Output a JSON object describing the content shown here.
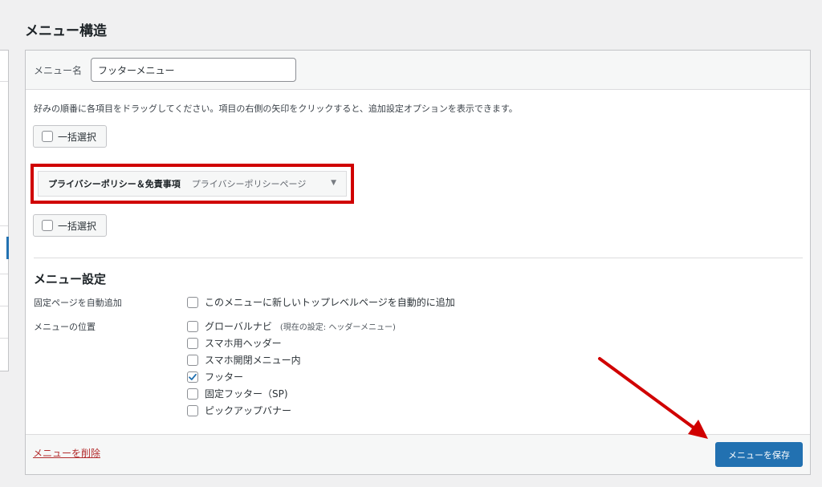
{
  "page": {
    "title": "メニュー構造"
  },
  "header": {
    "name_label": "メニュー名",
    "name_value": "フッターメニュー"
  },
  "instructions": "好みの順番に各項目をドラッグしてください。項目の右側の矢印をクリックすると、追加設定オプションを表示できます。",
  "bulk_select": {
    "label": "一括選択"
  },
  "menu_items": [
    {
      "title": "プライバシーポリシー＆免責事項",
      "type": "プライバシーポリシーページ"
    }
  ],
  "settings": {
    "heading": "メニュー設定",
    "auto_add": {
      "label": "固定ページを自動追加",
      "option": "このメニューに新しいトップレベルページを自動的に追加",
      "checked": false
    },
    "locations": {
      "label": "メニューの位置",
      "options": [
        {
          "label": "グローバルナビ",
          "note": "(現在の設定: ヘッダーメニュー)",
          "checked": false
        },
        {
          "label": "スマホ用ヘッダー",
          "note": "",
          "checked": false
        },
        {
          "label": "スマホ開閉メニュー内",
          "note": "",
          "checked": false
        },
        {
          "label": "フッター",
          "note": "",
          "checked": true
        },
        {
          "label": "固定フッター（SP)",
          "note": "",
          "checked": false
        },
        {
          "label": "ピックアップバナー",
          "note": "",
          "checked": false
        }
      ]
    }
  },
  "footer": {
    "delete_label": "メニューを削除",
    "save_label": "メニューを保存"
  },
  "colors": {
    "primary": "#2271b1",
    "danger": "#b32d2e",
    "highlight": "#d00000",
    "check": "#2271b1"
  },
  "icons": {
    "dropdown": "triangle-down-icon",
    "check": "checkmark-icon"
  }
}
